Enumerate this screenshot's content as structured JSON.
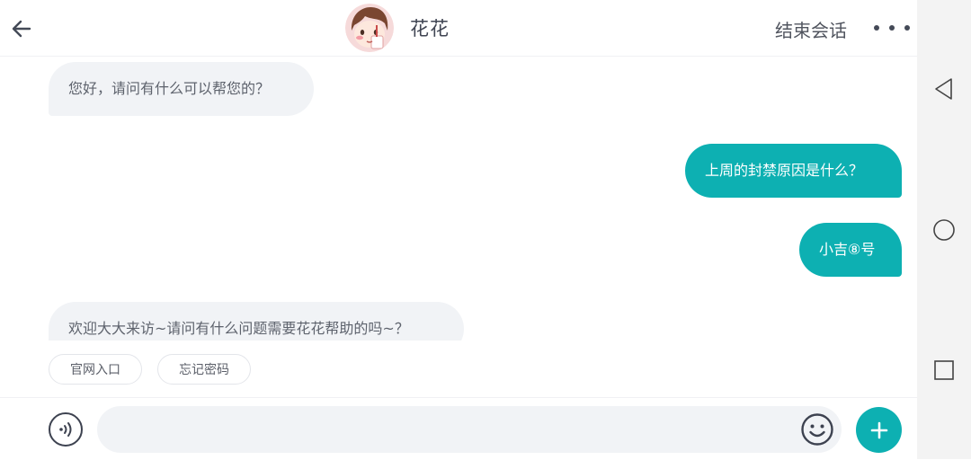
{
  "header": {
    "title": "花花",
    "end_session": "结束会话"
  },
  "messages": [
    {
      "from": "bot",
      "text": "您好，请问有什么可以帮您的？"
    },
    {
      "from": "user",
      "text": "上周的封禁原因是什么？"
    },
    {
      "from": "user",
      "text": "小吉⑧号"
    },
    {
      "from": "bot",
      "text": "欢迎大大来访~请问有什么问题需要花花帮助的吗~？"
    }
  ],
  "quick_replies": [
    "官网入口",
    "忘记密码"
  ],
  "input": {
    "value": "",
    "placeholder": ""
  },
  "colors": {
    "accent": "#0db0b2",
    "bot_bubble": "#f1f3f6",
    "text_dark": "#3f4452"
  },
  "icons": {
    "back": "arrow-left-icon",
    "more": "ellipsis-icon",
    "voice": "voice-icon",
    "emoji": "smiley-icon",
    "plus": "plus-icon",
    "nav_back": "triangle-back-icon",
    "nav_home": "circle-home-icon",
    "nav_recents": "square-recents-icon"
  }
}
